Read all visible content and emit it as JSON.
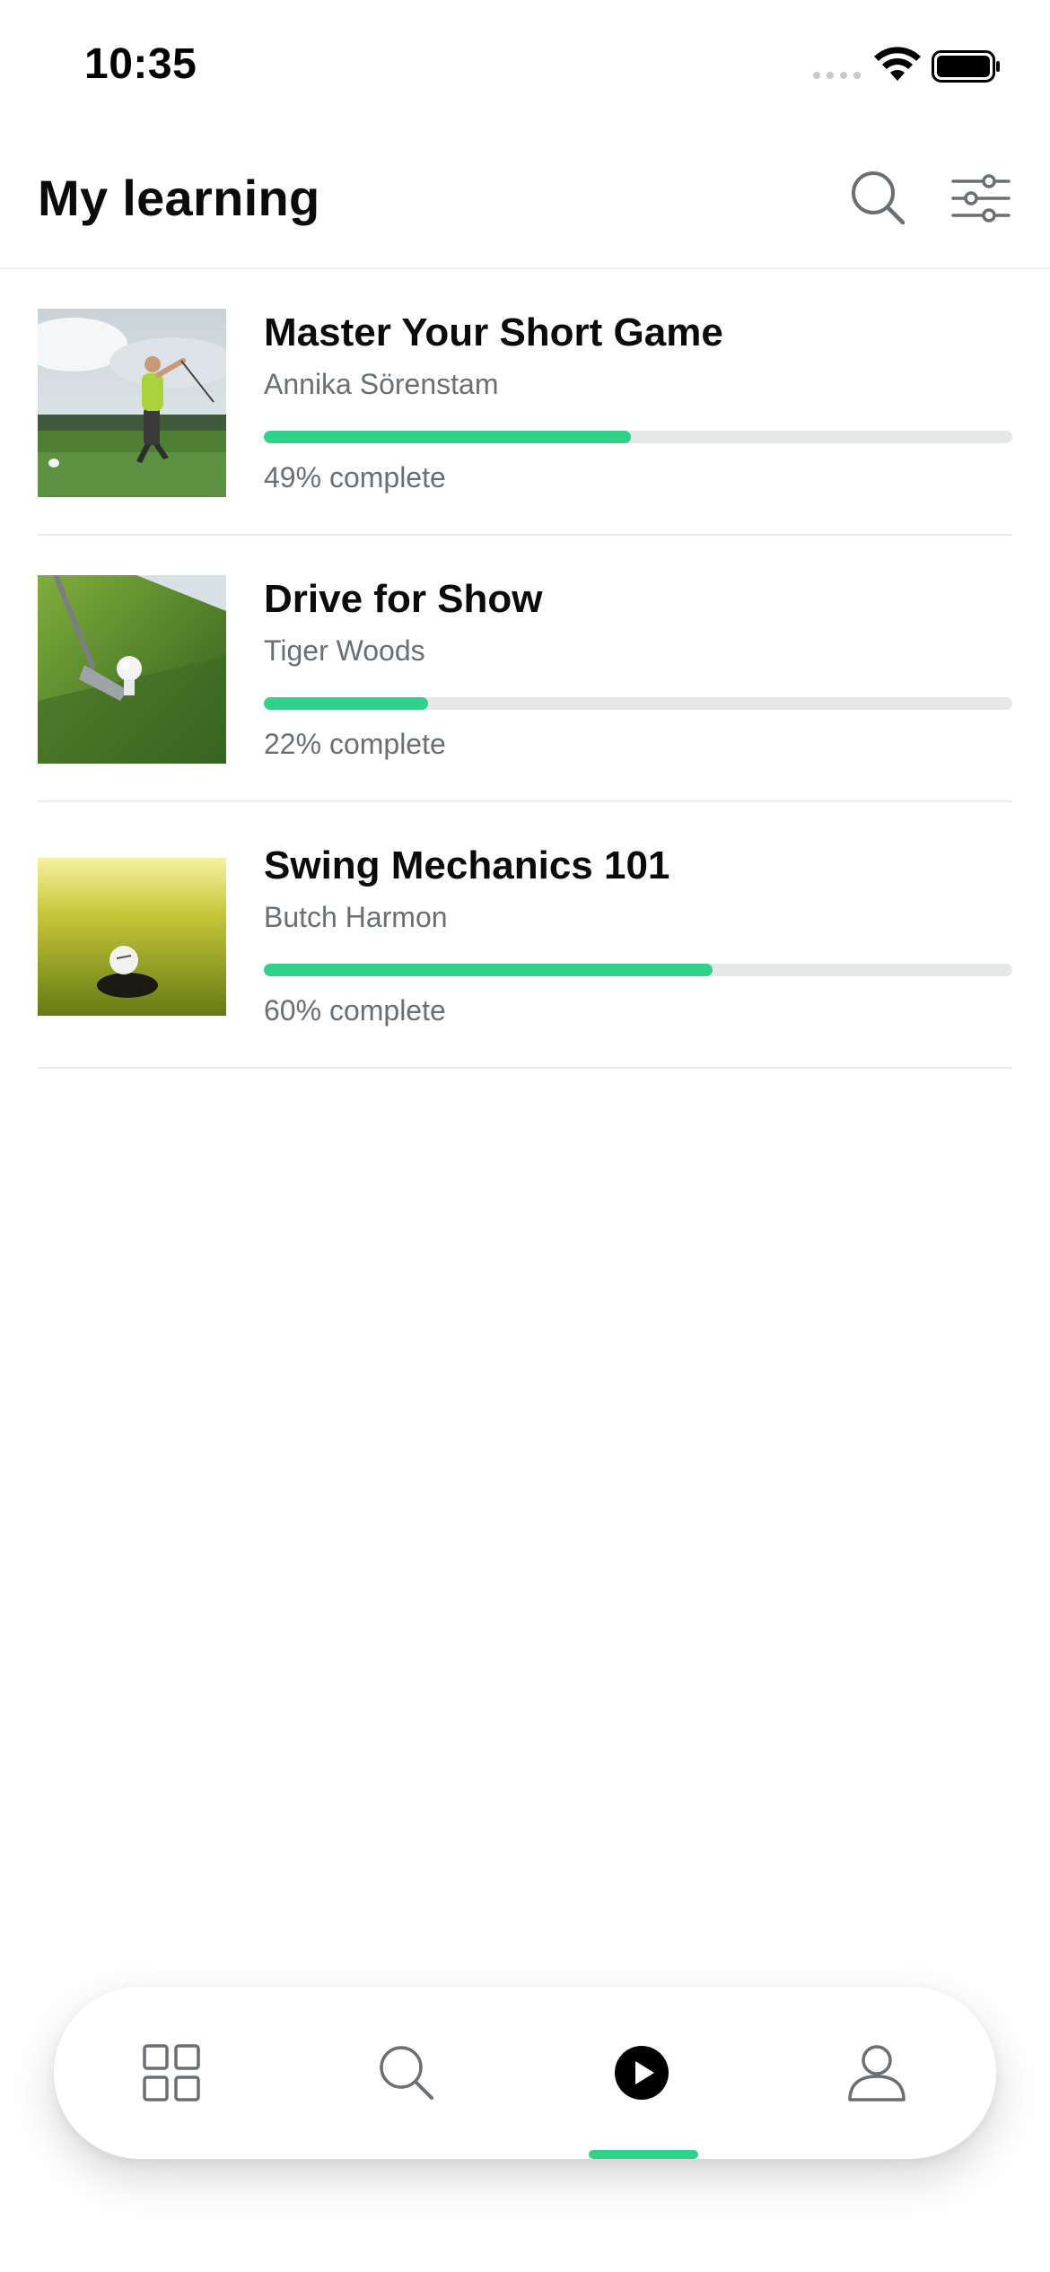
{
  "status_bar": {
    "time": "10:35",
    "icons": [
      "signal-icon",
      "wifi-icon",
      "battery-icon"
    ]
  },
  "header": {
    "title": "My learning",
    "icons": [
      "search-icon",
      "filter-icon"
    ]
  },
  "courses": [
    {
      "title": "Master Your Short Game",
      "author": "Annika Sörenstam",
      "progress_percent": 49,
      "progress_text": "49% complete",
      "thumbnail": "golfer-swing-photo"
    },
    {
      "title": "Drive for Show",
      "author": "Tiger Woods",
      "progress_percent": 22,
      "progress_text": "22% complete",
      "thumbnail": "club-and-ball-photo"
    },
    {
      "title": "Swing Mechanics 101",
      "author": "Butch Harmon",
      "progress_percent": 60,
      "progress_text": "60% complete",
      "thumbnail": "ball-near-hole-photo"
    }
  ],
  "bottom_nav": {
    "items": [
      {
        "icon": "grid-icon",
        "active": false
      },
      {
        "icon": "search-icon",
        "active": false
      },
      {
        "icon": "play-icon",
        "active": true
      },
      {
        "icon": "profile-icon",
        "active": false
      }
    ]
  },
  "colors": {
    "accent": "#2fd18b",
    "track": "#e6e8e8",
    "secondary_text": "#6a6f73",
    "divider": "#ececec"
  }
}
